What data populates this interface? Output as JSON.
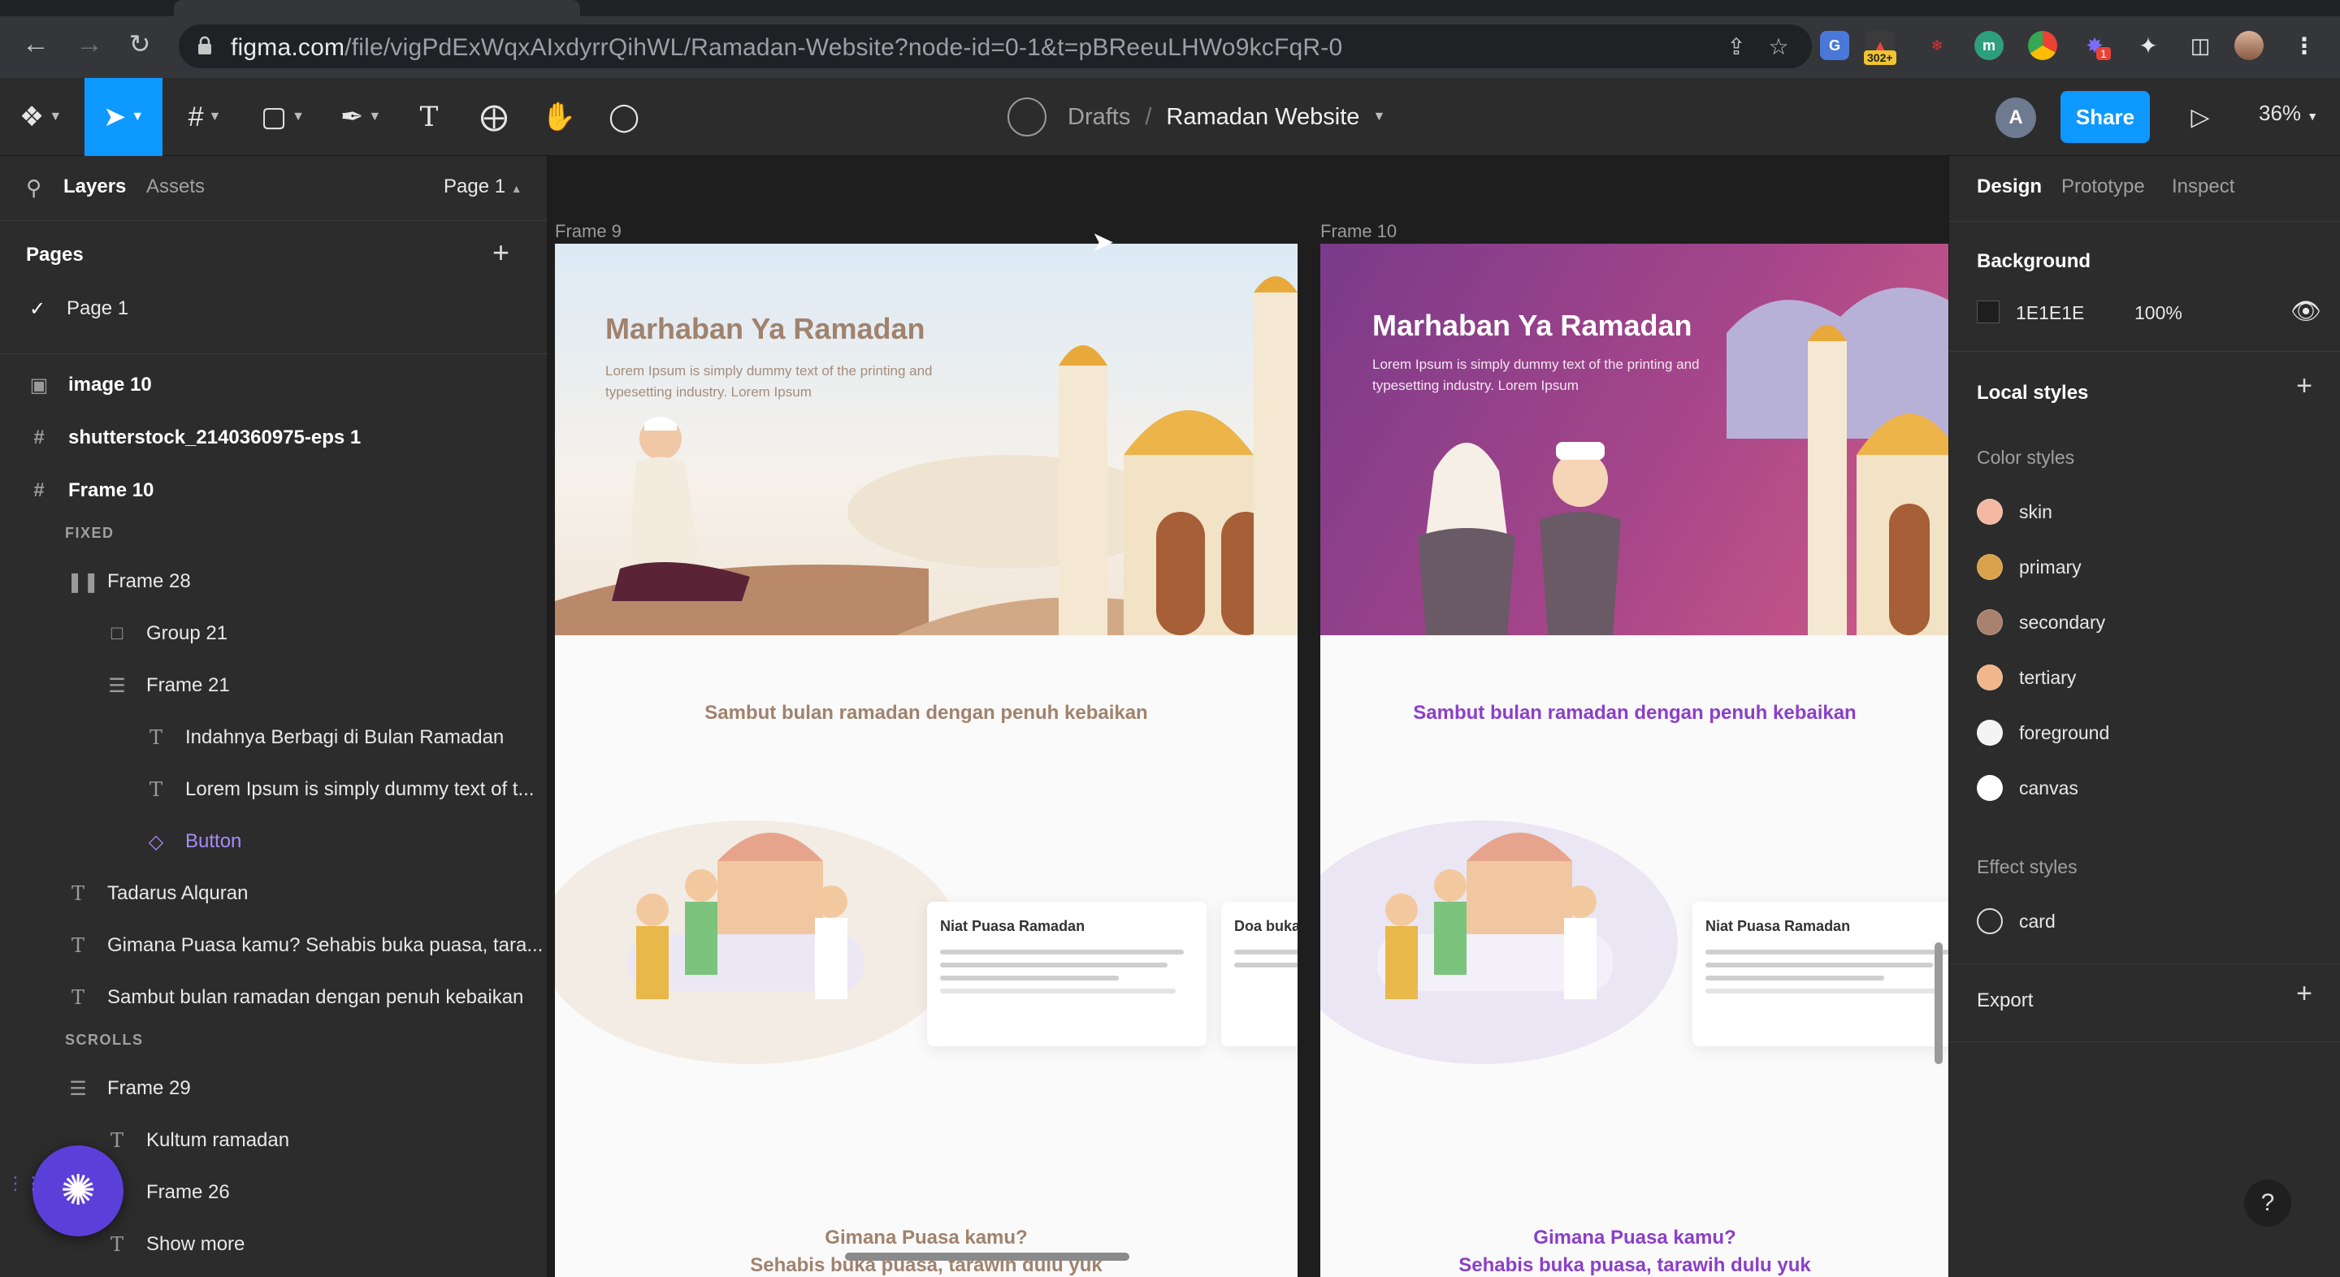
{
  "browser": {
    "url_host": "figma.com",
    "url_path": "/file/vigPdExWqxAIxdyrrQihWL/Ramadan-Website?node-id=0-1&t=pBReeuLHWo9kcFqR-0",
    "extension_badge": "302+",
    "extension_badge2": "1"
  },
  "toolbar": {
    "breadcrumb_drafts": "Drafts",
    "breadcrumb_sep": "/",
    "file_name": "Ramadan Website",
    "avatar_initial": "A",
    "share_label": "Share",
    "zoom_level": "36%"
  },
  "left_panel": {
    "tab_layers": "Layers",
    "tab_assets": "Assets",
    "current_page": "Page 1",
    "pages_heading": "Pages",
    "pages": [
      "Page 1"
    ],
    "layers": [
      {
        "name": "image 10",
        "icon": "image-icon"
      },
      {
        "name": "shutterstock_2140360975-eps 1",
        "icon": "frame-icon"
      },
      {
        "name": "Frame 10",
        "icon": "frame-icon"
      },
      {
        "name": "FIXED",
        "icon": "section-caption"
      },
      {
        "name": "Frame 28",
        "icon": "horizontal-autolayout-icon"
      },
      {
        "name": "Group 21",
        "icon": "group-icon"
      },
      {
        "name": "Frame 21",
        "icon": "vertical-autolayout-icon"
      },
      {
        "name": "Indahnya Berbagi di Bulan Ramadan",
        "icon": "text-icon"
      },
      {
        "name": "Lorem Ipsum is simply dummy text of t...",
        "icon": "text-icon"
      },
      {
        "name": "Button",
        "icon": "component-instance-icon"
      },
      {
        "name": "Tadarus Alquran",
        "icon": "text-icon"
      },
      {
        "name": "Gimana Puasa kamu? Sehabis buka puasa, tara...",
        "icon": "text-icon"
      },
      {
        "name": "Sambut bulan ramadan dengan penuh kebaikan",
        "icon": "text-icon"
      },
      {
        "name": "SCROLLS",
        "icon": "section-caption"
      },
      {
        "name": "Frame 29",
        "icon": "vertical-autolayout-icon"
      },
      {
        "name": "Kultum ramadan",
        "icon": "text-icon"
      },
      {
        "name": "Frame 26",
        "icon": "frame-icon"
      },
      {
        "name": "Show more",
        "icon": "text-icon"
      }
    ]
  },
  "canvas": {
    "frame9_label": "Frame 9",
    "frame10_label": "Frame 10",
    "frame9": {
      "hero_title": "Marhaban Ya Ramadan",
      "hero_sub": "Lorem Ipsum is simply dummy text of the printing and typesetting industry. Lorem Ipsum",
      "section_title": "Sambut bulan ramadan dengan penuh kebaikan",
      "card1_title": "Niat Puasa Ramadan",
      "card2_title": "Doa buka",
      "q1": "Gimana Puasa kamu?",
      "q2": "Sehabis buka puasa, tarawih dulu yuk",
      "accent": "#a0826d"
    },
    "frame10": {
      "hero_title": "Marhaban Ya Ramadan",
      "hero_sub": "Lorem Ipsum is simply dummy text of the printing and typesetting industry. Lorem Ipsum",
      "section_title": "Sambut bulan ramadan dengan penuh kebaikan",
      "card1_title": "Niat Puasa Ramadan",
      "q1": "Gimana Puasa kamu?",
      "q2": "Sehabis buka puasa, tarawih dulu yuk",
      "accent": "#8b3fc9"
    }
  },
  "right_panel": {
    "tab_design": "Design",
    "tab_prototype": "Prototype",
    "tab_inspect": "Inspect",
    "background_heading": "Background",
    "background_hex": "1E1E1E",
    "background_opacity": "100%",
    "local_styles_heading": "Local styles",
    "color_styles_heading": "Color styles",
    "color_styles": [
      {
        "name": "skin",
        "color": "#f2b8a2"
      },
      {
        "name": "primary",
        "color": "#d9a14a"
      },
      {
        "name": "secondary",
        "color": "#a8826e"
      },
      {
        "name": "tertiary",
        "color": "#f1b78a"
      },
      {
        "name": "foreground",
        "color": "#f4f4f4"
      },
      {
        "name": "canvas",
        "color": "#ffffff"
      }
    ],
    "effect_styles_heading": "Effect styles",
    "effect_styles": [
      "card"
    ],
    "export_heading": "Export"
  },
  "help_label": "?"
}
